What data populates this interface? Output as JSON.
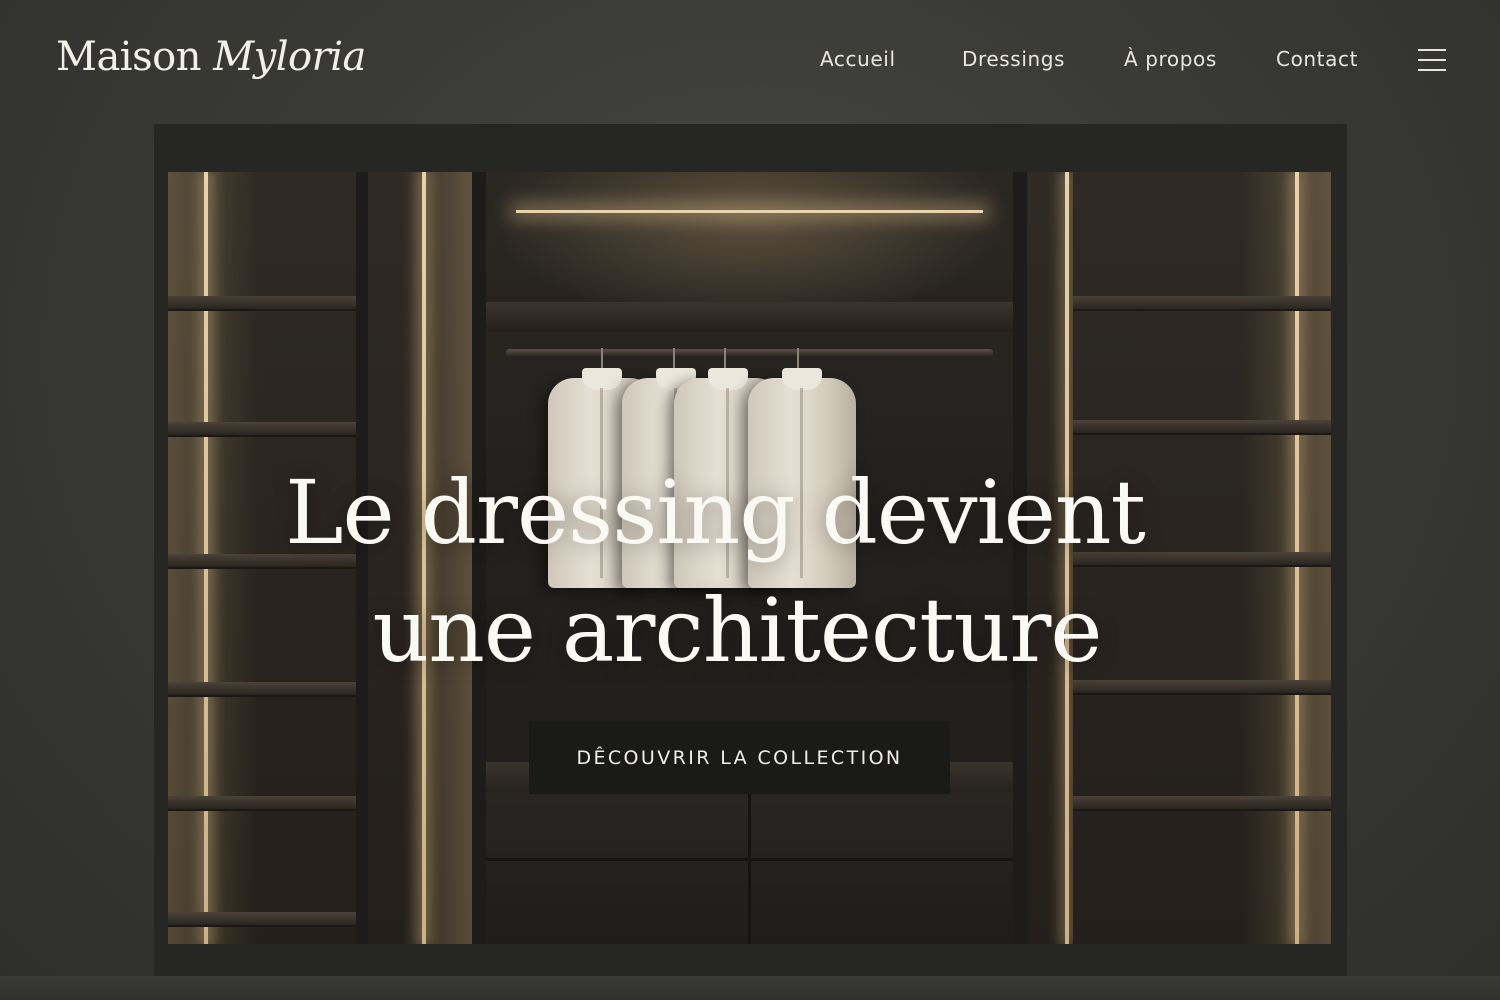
{
  "brand": {
    "name_regular": "Maison",
    "name_italic": "Myloria"
  },
  "nav": {
    "items": [
      {
        "label": "Accueil"
      },
      {
        "label": "Dressings"
      },
      {
        "label": "À propos"
      },
      {
        "label": "Contact"
      }
    ],
    "menu_icon": "hamburger-menu-icon"
  },
  "hero": {
    "title_line1": "Le dressing devient",
    "title_line2": "une architecture",
    "cta_label": "DÊCOUVRIR LA COLLECTION",
    "background_image": "illuminated walk-in wardrobe with shelves, hanging white shirts and drawers"
  },
  "colors": {
    "background": "#3a3a37",
    "text": "#f2efe8",
    "cta_background": "#1a1a19",
    "led_light": "#e8d3ad"
  }
}
